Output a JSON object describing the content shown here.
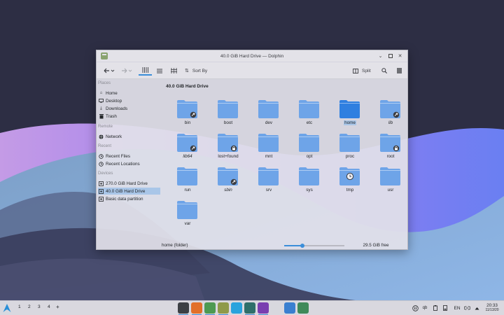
{
  "window": {
    "title": "40.0 GiB Hard Drive — Dolphin"
  },
  "toolbar": {
    "sort_label": "Sort By",
    "split_label": "Split"
  },
  "sidebar": {
    "places_header": "Places",
    "places": [
      {
        "label": "Home",
        "icon": "home-icon"
      },
      {
        "label": "Desktop",
        "icon": "desktop-icon"
      },
      {
        "label": "Downloads",
        "icon": "download-icon"
      },
      {
        "label": "Trash",
        "icon": "trash-icon"
      }
    ],
    "remote_header": "Remote",
    "remote": [
      {
        "label": "Network",
        "icon": "network-icon"
      }
    ],
    "recent_header": "Recent",
    "recent": [
      {
        "label": "Recent Files",
        "icon": "clock-icon"
      },
      {
        "label": "Recent Locations",
        "icon": "clock-icon"
      }
    ],
    "devices_header": "Devices",
    "devices": [
      {
        "label": "270.0 GiB Hard Drive",
        "icon": "drive-icon"
      },
      {
        "label": "40.0 GiB Hard Drive",
        "icon": "drive-icon",
        "selected": true
      },
      {
        "label": "Basic data partition",
        "icon": "drive-icon"
      }
    ]
  },
  "content": {
    "path": "40.0 GiB Hard Drive",
    "folders": [
      {
        "name": "bin",
        "badge": "link"
      },
      {
        "name": "boot"
      },
      {
        "name": "dev"
      },
      {
        "name": "etc"
      },
      {
        "name": "home",
        "selected": true
      },
      {
        "name": "lib",
        "badge": "link",
        "italic": true
      },
      {
        "name": "lib64",
        "badge": "link",
        "italic": true
      },
      {
        "name": "lost+found",
        "badge": "lock"
      },
      {
        "name": "mnt"
      },
      {
        "name": "opt"
      },
      {
        "name": "proc"
      },
      {
        "name": "root",
        "badge": "lock"
      },
      {
        "name": "run"
      },
      {
        "name": "sbin",
        "badge": "link",
        "italic": true
      },
      {
        "name": "srv"
      },
      {
        "name": "sys"
      },
      {
        "name": "tmp",
        "overlay": "temp"
      },
      {
        "name": "usr"
      },
      {
        "name": "var"
      }
    ]
  },
  "status": {
    "text": "home (folder)",
    "zoom": 0.3,
    "free_space": "29.5 GiB free",
    "used_fraction": 0.26
  },
  "taskbar": {
    "desktops": [
      "1",
      "2",
      "3",
      "4",
      "+"
    ],
    "apps": [
      {
        "name": "terminal-icon",
        "color": "#3c3f44",
        "active": true
      },
      {
        "name": "firefox-icon",
        "color": "#e2702a",
        "active": true
      },
      {
        "name": "android-studio-icon",
        "color": "#4e9a52",
        "active": true
      },
      {
        "name": "text-editor-icon",
        "color": "#8f9a4a",
        "active": true
      },
      {
        "name": "telegram-icon",
        "color": "#2aa3dd",
        "active": false
      },
      {
        "name": "monitor-icon",
        "color": "#2f6f6a",
        "active": true
      },
      {
        "name": "pinwheel-icon",
        "color": "#7a3fb0",
        "active": true
      },
      {
        "name": "gamepad-icon",
        "color": "#d8d8de",
        "active": false
      },
      {
        "name": "qbittorrent-icon",
        "color": "#3a7fd0",
        "active": false
      },
      {
        "name": "package-icon",
        "color": "#3f8a5a",
        "active": false
      }
    ],
    "tray_lang": "EN",
    "time": "20:33",
    "date": "11/13/20"
  },
  "colors": {
    "accent": "#3b8ed9",
    "folder": "#6ea4e8",
    "selection": "#a9c6e8"
  }
}
